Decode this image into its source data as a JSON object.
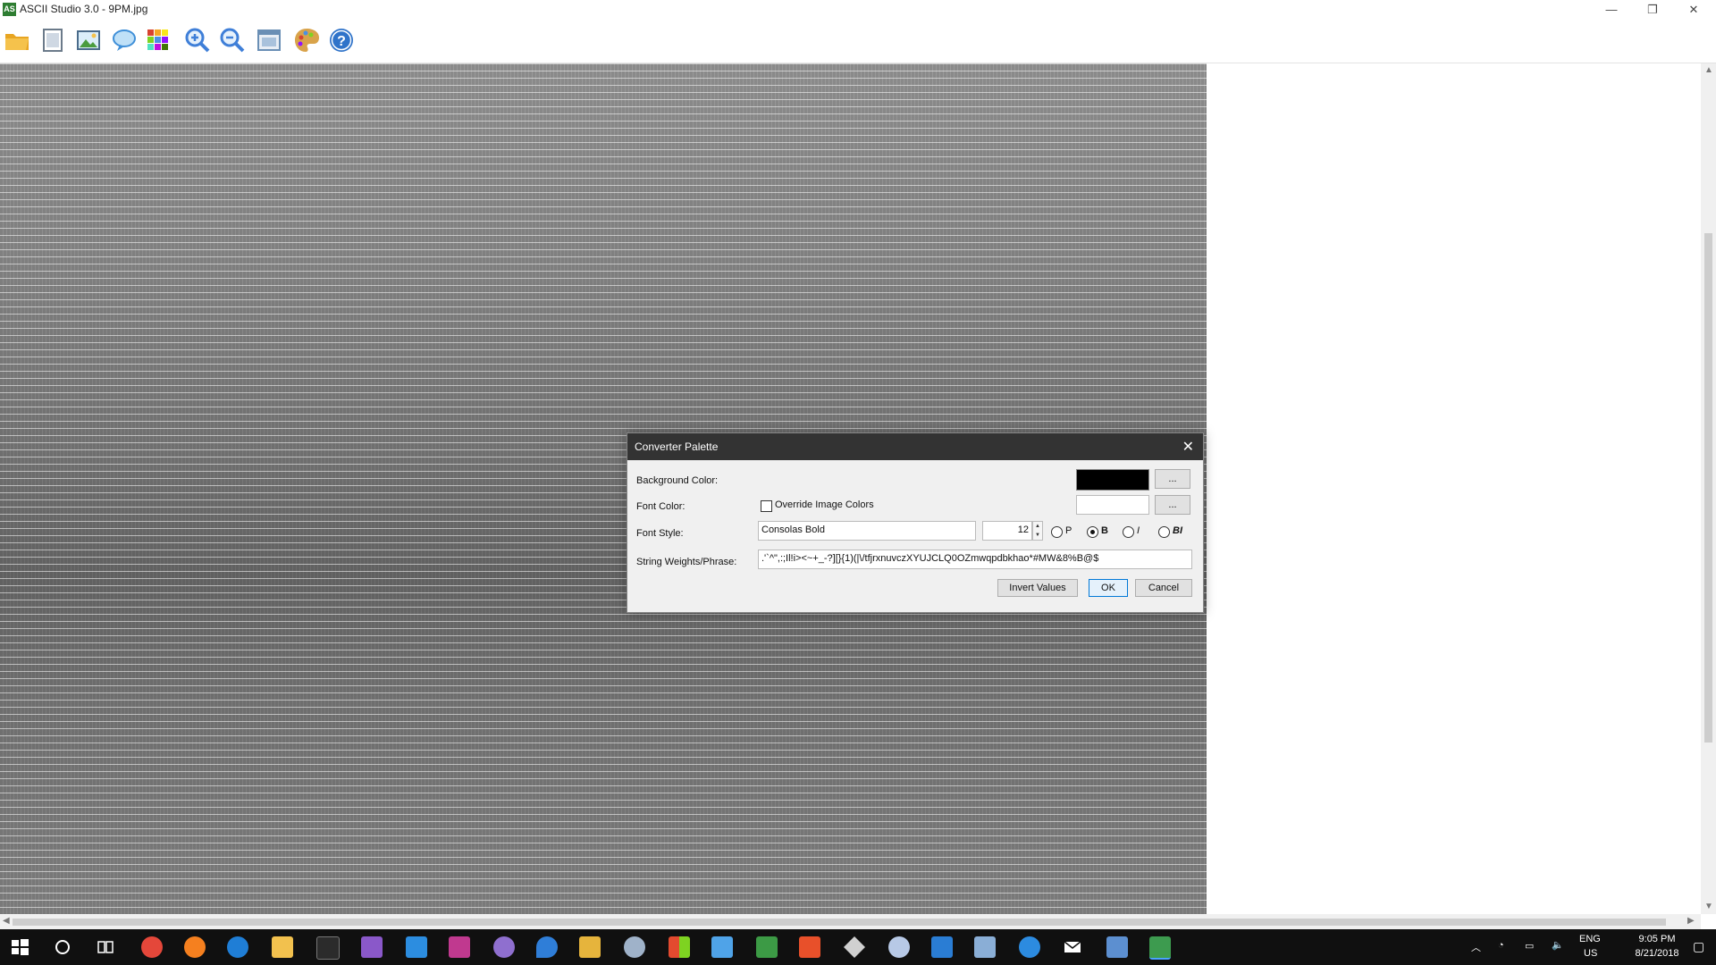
{
  "window": {
    "title": "ASCII Studio 3.0 - 9PM.jpg",
    "app_icon_text": "AS",
    "minimize_glyph": "—",
    "maximize_glyph": "❐",
    "close_glyph": "✕"
  },
  "toolbar": {
    "items": [
      {
        "icon": "open-folder-icon",
        "color": "#e8a522"
      },
      {
        "icon": "new-document-icon",
        "color": "#9aa7b5"
      },
      {
        "icon": "image-icon",
        "color": "#4a9c3f"
      },
      {
        "icon": "speech-bubble-icon",
        "color": "#3f8fd8"
      },
      {
        "icon": "color-grid-icon",
        "color": "#d8432f"
      },
      {
        "icon": "zoom-in-icon",
        "color": "#3f7fd8"
      },
      {
        "icon": "zoom-out-icon",
        "color": "#3f7fd8"
      },
      {
        "icon": "screenshot-icon",
        "color": "#6a8fb5"
      },
      {
        "icon": "palette-icon",
        "color": "#d9a34a"
      },
      {
        "icon": "help-icon",
        "color": "#2f73c9"
      }
    ]
  },
  "dialog": {
    "title": "Converter Palette",
    "close_glyph": "✕",
    "background_color_label": "Background Color:",
    "background_color": "#000000",
    "font_color_label": "Font Color:",
    "font_color": "#ffffff",
    "override_label": "Override Image Colors",
    "override_checked": false,
    "font_style_label": "Font Style:",
    "font_name": "Consolas Bold",
    "font_size": "12",
    "style_options": [
      {
        "label": "P",
        "selected": false
      },
      {
        "label": "B",
        "selected": true
      },
      {
        "label": "I",
        "selected": false
      },
      {
        "label": "BI",
        "selected": false
      }
    ],
    "weights_label": "String Weights/Phrase:",
    "weights_value": ".'`^\",:;Il!i><~+_-?][}{1)(|\\/tfjrxnuvczXYUJCLQ0OZmwqpdbkhao*#MW&8%B@$",
    "browse_label": "...",
    "buttons": {
      "invert": "Invert Values",
      "ok": "OK",
      "cancel": "Cancel"
    }
  },
  "taskbar": {
    "icons": [
      {
        "icon": "windows-start-icon",
        "color": "#ffffff"
      },
      {
        "icon": "search-circle-icon",
        "color": "#ffffff"
      },
      {
        "icon": "task-view-icon",
        "color": "#ffffff"
      },
      {
        "icon": "chrome-icon",
        "color": "#e4473a"
      },
      {
        "icon": "firefox-icon",
        "color": "#f5801f"
      },
      {
        "icon": "edge-icon",
        "color": "#1f7ed6"
      },
      {
        "icon": "file-explorer-icon",
        "color": "#f2c14e"
      },
      {
        "icon": "terminal-icon",
        "color": "#2b2b2b"
      },
      {
        "icon": "visual-studio-icon",
        "color": "#8a58c9"
      },
      {
        "icon": "vscode-icon",
        "color": "#2c8de0"
      },
      {
        "icon": "rider-icon",
        "color": "#c0398f"
      },
      {
        "icon": "github-desktop-icon",
        "color": "#8f6fcf"
      },
      {
        "icon": "maps-pin-icon",
        "color": "#2f7ed8"
      },
      {
        "icon": "paint-tool-icon",
        "color": "#e6b43c"
      },
      {
        "icon": "settings-gear-icon",
        "color": "#9fb2c9"
      },
      {
        "icon": "color-tiles-icon",
        "color": "#e34a2f"
      },
      {
        "icon": "store-bag-icon",
        "color": "#4fa3e8"
      },
      {
        "icon": "spreadsheet-icon",
        "color": "#3c9a45"
      },
      {
        "icon": "office-icon",
        "color": "#e8502a"
      },
      {
        "icon": "unity-icon",
        "color": "#d0d0d0"
      },
      {
        "icon": "swift-bird-icon",
        "color": "#b7c9e6"
      },
      {
        "icon": "vs-blue-icon",
        "color": "#2a7dd4"
      },
      {
        "icon": "cube-icon",
        "color": "#8aaed6"
      },
      {
        "icon": "edge-beta-icon",
        "color": "#2c8be0"
      },
      {
        "icon": "mail-icon",
        "color": "#ffffff"
      },
      {
        "icon": "box-3d-icon",
        "color": "#5c8fd0"
      },
      {
        "icon": "ascii-studio-icon",
        "color": "#3d9b4f"
      }
    ],
    "tray": {
      "up_arrow": "︿",
      "network": "◔",
      "battery": "▭",
      "volume": "🔈",
      "language_top": "ENG",
      "language_bottom": "US",
      "time": "9:05 PM",
      "date": "8/21/2018",
      "notifications": "▢"
    }
  }
}
